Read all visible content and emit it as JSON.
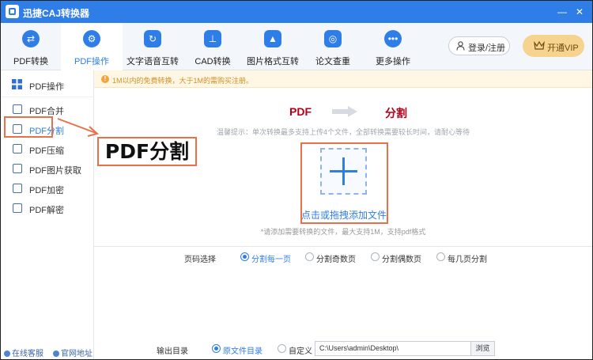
{
  "app": {
    "title": "迅捷CAJ转换器"
  },
  "window": {
    "minimize": "—",
    "close": "✕"
  },
  "toolbar": {
    "tools": [
      {
        "label": "PDF转换",
        "icon": "swap-arrows-icon"
      },
      {
        "label": "PDF操作",
        "icon": "gear-icon",
        "active": true
      },
      {
        "label": "文字语音互转",
        "icon": "voice-convert-icon"
      },
      {
        "label": "CAD转换",
        "icon": "cad-icon"
      },
      {
        "label": "图片格式互转",
        "icon": "image-icon"
      },
      {
        "label": "论文查重",
        "icon": "paper-check-icon"
      },
      {
        "label": "更多操作",
        "icon": "more-dots-icon"
      }
    ],
    "login_label": "登录/注册",
    "vip_label": "开通VIP"
  },
  "sidebar": {
    "header": "PDF操作",
    "items": [
      {
        "label": "PDF合并",
        "icon": "merge-icon"
      },
      {
        "label": "PDF分割",
        "icon": "split-icon",
        "active": true
      },
      {
        "label": "PDF压缩",
        "icon": "compress-icon"
      },
      {
        "label": "PDF图片获取",
        "icon": "image-extract-icon"
      },
      {
        "label": "PDF加密",
        "icon": "lock-icon"
      },
      {
        "label": "PDF解密",
        "icon": "unlock-icon"
      }
    ],
    "footer": {
      "service": "在线客服",
      "website": "官网地址"
    }
  },
  "annotation": {
    "label": "PDF分割"
  },
  "notice": {
    "text": "1M以内的免费转换，大于1M的需购买注册。"
  },
  "flow": {
    "from": "PDF",
    "to": "分割"
  },
  "tip": "温馨提示：单次转换最多支持上传4个文件，全部转换需要较长时间，请耐心等待",
  "upload": {
    "label": "点击或拖拽添加文件",
    "note": "*请添加需要转换的文件，最大支持1M，支持pdf格式"
  },
  "page_select": {
    "label": "页码选择",
    "options": [
      "分割每一页",
      "分割奇数页",
      "分割偶数页",
      "每几页分割"
    ],
    "selected": "分割每一页"
  },
  "output": {
    "label": "输出目录",
    "options": [
      "原文件目录",
      "自定义"
    ],
    "selected": "原文件目录",
    "path": "C:\\Users\\admin\\Desktop\\",
    "browse_label": "浏览"
  },
  "colors": {
    "accent": "#2f7ee8",
    "highlight": "#e8704a",
    "flow_text": "#b3001b",
    "notice_text": "#d08f27",
    "vip_bg": "#f6d38e"
  }
}
